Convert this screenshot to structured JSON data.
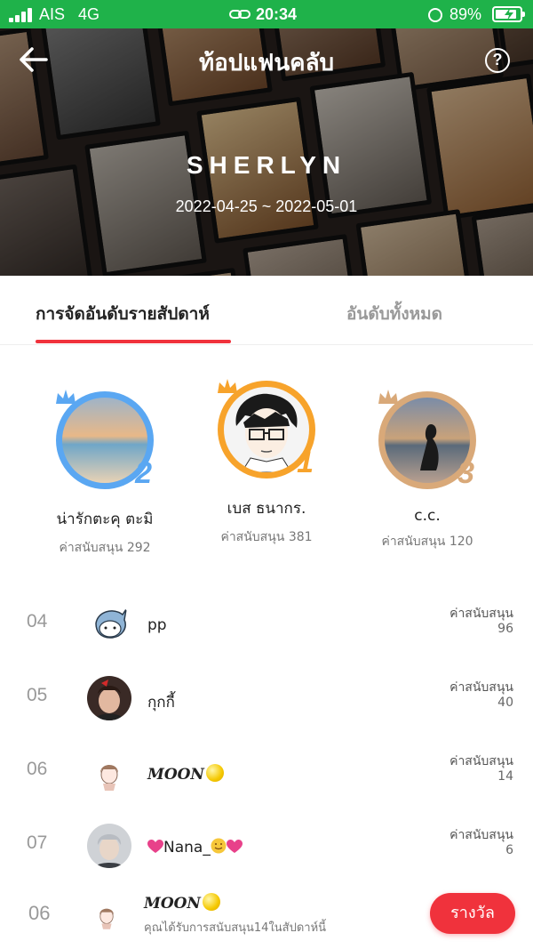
{
  "status_bar": {
    "carrier": "AIS",
    "network": "4G",
    "time": "20:34",
    "battery": "89%",
    "battery_level": 0.89
  },
  "header": {
    "title": "ท้อปแฟนคลับ",
    "streamer_name": "SHERLYN",
    "date_range": "2022-04-25 ~ 2022-05-01"
  },
  "tabs": [
    {
      "label": "การจัดอันดับรายสัปดาห์",
      "active": true
    },
    {
      "label": "อันดับทั้งหมด",
      "active": false
    }
  ],
  "podium": [
    {
      "rank": "2",
      "name": "น่ารักตะคุ ตะมิ",
      "score": "ค่าสนับสนุน 292",
      "ring_color": "#5aa7f2"
    },
    {
      "rank": "1",
      "name": "เบส ธนากร.",
      "score": "ค่าสนับสนุน 381",
      "ring_color": "#f7a32b"
    },
    {
      "rank": "3",
      "name": "c.c.",
      "score": "ค่าสนับสนุน 120",
      "ring_color": "#d9a979"
    }
  ],
  "ranking": [
    {
      "rank": "04",
      "name": "pp",
      "support_label": "ค่าสนับสนุน",
      "support_value": "96"
    },
    {
      "rank": "05",
      "name": "กุกกี้",
      "support_label": "ค่าสนับสนุน",
      "support_value": "40"
    },
    {
      "rank": "06",
      "name": "MOON",
      "support_label": "ค่าสนับสนุน",
      "support_value": "14"
    },
    {
      "rank": "07",
      "name": "Nana_",
      "support_label": "ค่าสนับสนุน",
      "support_value": "6"
    }
  ],
  "my_rank": {
    "rank": "06",
    "name": "MOON",
    "note": "คุณได้รับการสนับสนุน14ในสัปดาห์นี้",
    "reward_button": "รางวัล"
  },
  "colors": {
    "status_green": "#1fb24a",
    "accent_red": "#f0323c"
  }
}
